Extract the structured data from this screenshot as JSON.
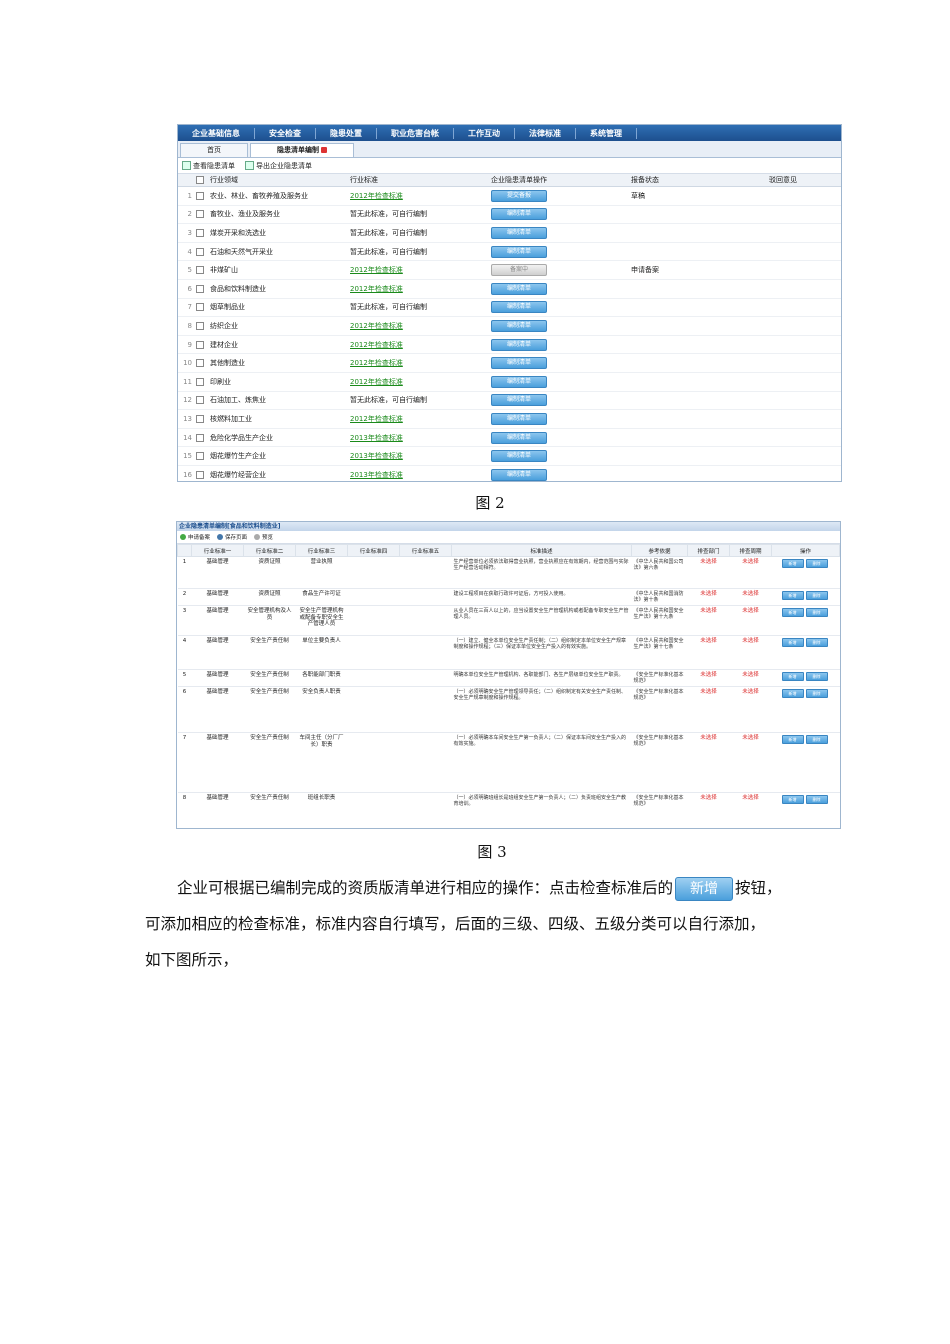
{
  "figure2": {
    "caption": "图 2",
    "menu": [
      "企业基础信息",
      "安全检查",
      "隐患处置",
      "职业危害台帐",
      "工作互动",
      "法律标准",
      "系统管理"
    ],
    "tabs": [
      "首页",
      "隐患清单编制"
    ],
    "toolbar": [
      "查看隐患清单",
      "导出企业隐患清单"
    ],
    "columns": [
      "",
      "",
      "行业领域",
      "行业标准",
      "企业隐患清单操作",
      "报备状态",
      "驳回意见"
    ],
    "rows": [
      {
        "n": "1",
        "field": "农业、林业、畜牧养殖及服务业",
        "standard": "2012年检查标准",
        "std_link": true,
        "op": "提交备报",
        "status": "草稿"
      },
      {
        "n": "2",
        "field": "畜牧业、渔业及服务业",
        "standard": "暂无此标准，可自行编制",
        "std_link": false,
        "op": "编制清单",
        "status": ""
      },
      {
        "n": "3",
        "field": "煤炭开采和洗选业",
        "standard": "暂无此标准，可自行编制",
        "std_link": false,
        "op": "编制清单",
        "status": ""
      },
      {
        "n": "4",
        "field": "石油和天然气开采业",
        "standard": "暂无此标准，可自行编制",
        "std_link": false,
        "op": "编制清单",
        "status": ""
      },
      {
        "n": "5",
        "field": "非煤矿山",
        "standard": "2012年检查标准",
        "std_link": true,
        "op": "备案中",
        "status": "申请备案",
        "grey": true
      },
      {
        "n": "6",
        "field": "食品和饮料制造业",
        "standard": "2012年检查标准",
        "std_link": true,
        "op": "编制清单",
        "status": ""
      },
      {
        "n": "7",
        "field": "烟草制品业",
        "standard": "暂无此标准，可自行编制",
        "std_link": false,
        "op": "编制清单",
        "status": ""
      },
      {
        "n": "8",
        "field": "纺织企业",
        "standard": "2012年检查标准",
        "std_link": true,
        "op": "编制清单",
        "status": ""
      },
      {
        "n": "9",
        "field": "建材企业",
        "standard": "2012年检查标准",
        "std_link": true,
        "op": "编制清单",
        "status": ""
      },
      {
        "n": "10",
        "field": "其他制造业",
        "standard": "2012年检查标准",
        "std_link": true,
        "op": "编制清单",
        "status": ""
      },
      {
        "n": "11",
        "field": "印刷业",
        "standard": "2012年检查标准",
        "std_link": true,
        "op": "编制清单",
        "status": ""
      },
      {
        "n": "12",
        "field": "石油加工、炼焦业",
        "standard": "暂无此标准，可自行编制",
        "std_link": false,
        "op": "编制清单",
        "status": ""
      },
      {
        "n": "13",
        "field": "核燃料加工业",
        "standard": "2012年检查标准",
        "std_link": true,
        "op": "编制清单",
        "status": ""
      },
      {
        "n": "14",
        "field": "危险化学品生产企业",
        "standard": "2013年检查标准",
        "std_link": true,
        "op": "编制清单",
        "status": ""
      },
      {
        "n": "15",
        "field": "烟花爆竹生产企业",
        "standard": "2013年检查标准",
        "std_link": true,
        "op": "编制清单",
        "status": ""
      },
      {
        "n": "16",
        "field": "烟花爆竹经营企业",
        "standard": "2013年检查标准",
        "std_link": true,
        "op": "编制清单",
        "status": ""
      }
    ]
  },
  "figure3": {
    "caption": "图 3",
    "title": "企业隐患清单编制[食品和饮料制造业]",
    "toolbar": [
      "申请备案",
      "保存页面",
      "预览"
    ],
    "columns": [
      "",
      "行业标准一",
      "行业标准二",
      "行业标准三",
      "行业标准四",
      "行业标准五",
      "标准描述",
      "参考依据",
      "排查部门",
      "排查周期",
      "操作"
    ],
    "row_ops": [
      "新增",
      "删除"
    ],
    "rows": [
      {
        "n": "1",
        "c1": "基础管理",
        "c2": "资质证照",
        "c3": "营业执照",
        "desc": "生产经营单位必须依法取得营业执照，营业执照应在有效期内，经营范围与实际生产经营活动相符。",
        "ref": "《中华人民共和国公司法》第六条",
        "dept": "未选择",
        "cycle": "未选择"
      },
      {
        "n": "2",
        "c1": "基础管理",
        "c2": "资质证照",
        "c3": "食品生产许可证",
        "desc": "建设工程项目在获取行政许可证后，方可投入使用。",
        "ref": "《中华人民共和国消防法》第十条",
        "dept": "未选择",
        "cycle": "未选择"
      },
      {
        "n": "3",
        "c1": "基础管理",
        "c2": "安全管理机构及人员",
        "c3": "安全生产管理机构或配备专职安全生产管理人员",
        "desc": "从业人员在三百人以上的，应当设置安全生产管理机构或者配备专职安全生产管理人员。",
        "ref": "《中华人民共和国安全生产法》第十九条",
        "dept": "未选择",
        "cycle": "未选择"
      },
      {
        "n": "4",
        "c1": "基础管理",
        "c2": "安全生产责任制",
        "c3": "单位主要负责人",
        "desc": "（一）建立、健全本单位安全生产责任制；（二）组织制定本单位安全生产规章制度和操作规程；（三）保证本单位安全生产投入的有效实施。",
        "ref": "《中华人民共和国安全生产法》第十七条",
        "dept": "未选择",
        "cycle": "未选择"
      },
      {
        "n": "5",
        "c1": "基础管理",
        "c2": "安全生产责任制",
        "c3": "各职能部门职责",
        "desc": "明确本单位安全生产管理机构、各职能部门、各生产层级单位安全生产职责。",
        "ref": "《安全生产标准化基本规范》",
        "dept": "未选择",
        "cycle": "未选择"
      },
      {
        "n": "6",
        "c1": "基础管理",
        "c2": "安全生产责任制",
        "c3": "安全负责人职责",
        "desc": "（一）必须明确安全生产管理领导责任；（二）组织制定有关安全生产责任制、安全生产规章制度和操作规程。",
        "ref": "《安全生产标准化基本规范》",
        "dept": "未选择",
        "cycle": "未选择"
      },
      {
        "n": "7",
        "c1": "基础管理",
        "c2": "安全生产责任制",
        "c3": "车间主任（分厂厂长）职责",
        "desc": "（一）必须明确本车间安全生产第一负责人；（二）保证本车间安全生产投入的有效实施。",
        "ref": "《安全生产标准化基本规范》",
        "dept": "未选择",
        "cycle": "未选择"
      },
      {
        "n": "8",
        "c1": "基础管理",
        "c2": "安全生产责任制",
        "c3": "班组长职责",
        "desc": "（一）必须明确班组长是班组安全生产第一负责人；（二）负责班组安全生产教育培训。",
        "ref": "《安全生产标准化基本规范》",
        "dept": "未选择",
        "cycle": "未选择"
      }
    ]
  },
  "paragraph": {
    "line1_a": "企业可根据已编制完成的资质版清单进行相应的操作：点击检查标准后的",
    "button": "新增",
    "line1_b": "按钮，",
    "line2": "可添加相应的检查标准，标准内容自行填写，后面的三级、四级、五级分类可以自行添加，",
    "line3": "如下图所示，"
  }
}
